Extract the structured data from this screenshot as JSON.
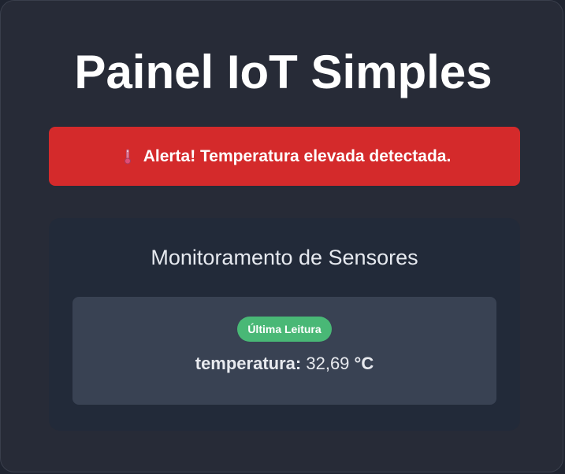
{
  "page": {
    "title": "Painel IoT Simples"
  },
  "alert": {
    "icon": "thermometer-icon",
    "text": "Alerta! Temperatura elevada detectada.",
    "color": "#d42a2b"
  },
  "monitor": {
    "title": "Monitoramento de Sensores",
    "reading": {
      "badge": "Última Leitura",
      "badge_color": "#49b876",
      "label": "temperatura:",
      "value": "32,69",
      "unit": "°C"
    }
  }
}
